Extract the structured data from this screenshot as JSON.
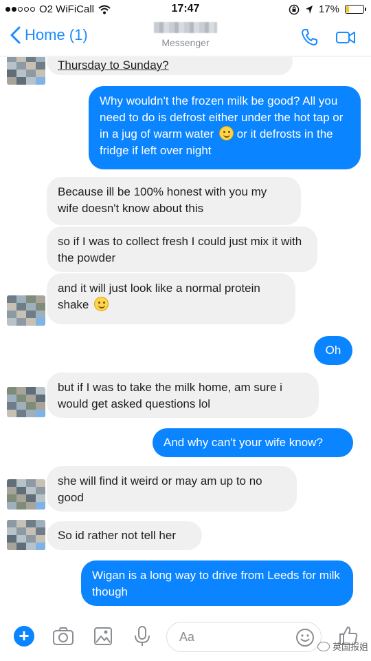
{
  "status_bar": {
    "carrier": "O2 WiFiCall",
    "time": "17:47",
    "battery": "17%",
    "battery_level": 0.17
  },
  "header": {
    "back_label": "Home (1)",
    "subtitle": "Messenger",
    "icons": [
      "chevron-left-icon",
      "phone-icon",
      "video-camera-icon"
    ]
  },
  "messages": [
    {
      "side": "in",
      "text": "Thursday to Sunday?",
      "avatar": true
    },
    {
      "side": "out",
      "text": "Why wouldn't the frozen milk be good? All you need to do is defrost either under the hot tap or in a jug of warm water",
      "emoji": "slightly-smiling-face",
      "text_after": " or it defrosts in the fridge if left over night"
    },
    {
      "side": "in",
      "text": "Because ill be 100% honest with you my wife doesn't know about this"
    },
    {
      "side": "in",
      "text": "so if I was to collect fresh I could just mix it with the powder"
    },
    {
      "side": "in",
      "text": "and it will just look like a normal protein shake",
      "emoji": "slightly-smiling-face",
      "avatar": true
    },
    {
      "side": "out",
      "text": "Oh"
    },
    {
      "side": "in",
      "text": "but if I was to take the milk home, am sure i would get asked questions lol",
      "avatar": true
    },
    {
      "side": "out",
      "text": "And why can't your wife know?"
    },
    {
      "side": "in",
      "text": "she will find it weird or may am up to no good",
      "avatar": true
    },
    {
      "side": "in",
      "text": "So id rather not tell her",
      "avatar": true
    },
    {
      "side": "out",
      "text": "Wigan is a long way to drive from Leeds for milk though"
    }
  ],
  "composer": {
    "placeholder": "Aa",
    "icons": [
      "plus-icon",
      "camera-icon",
      "image-icon",
      "microphone-icon",
      "emoji-icon",
      "thumbs-up-icon"
    ]
  },
  "watermark": "英国报姐",
  "colors": {
    "accent": "#0a84ff",
    "incoming_bubble": "#f0f0f0",
    "battery": "#f5c518"
  }
}
